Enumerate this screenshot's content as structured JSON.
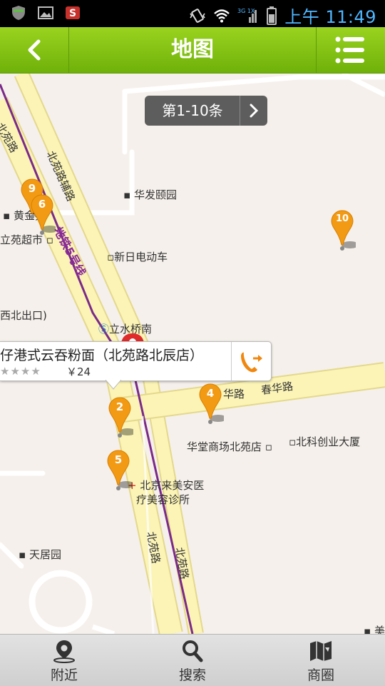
{
  "status_bar": {
    "time": "上午 11:49",
    "network": "3G 1X"
  },
  "header": {
    "title": "地图"
  },
  "pager": {
    "label": "第1-10条"
  },
  "map": {
    "pois": [
      "华发颐园",
      "黄金苑",
      "立苑超市",
      "新日电动车",
      "西北出口)",
      "立水桥南",
      "华堂商场北苑店",
      "北科创业大厦",
      "北京来美安医",
      "疗美容诊所",
      "天居园",
      "美"
    ],
    "roads": [
      "北苑路",
      "北苑路辅路",
      "地铁5号线",
      "华路",
      "春华路",
      "北苑路",
      "北苑路"
    ],
    "pins": [
      "9",
      "6",
      "10",
      "2",
      "4",
      "5"
    ]
  },
  "info_window": {
    "name": "仔港式云吞粉面（北苑路北辰店）",
    "rating_stars": "★★★★",
    "price": "￥24"
  },
  "tabs": [
    {
      "label": "附近"
    },
    {
      "label": "搜索"
    },
    {
      "label": "商圈"
    }
  ]
}
